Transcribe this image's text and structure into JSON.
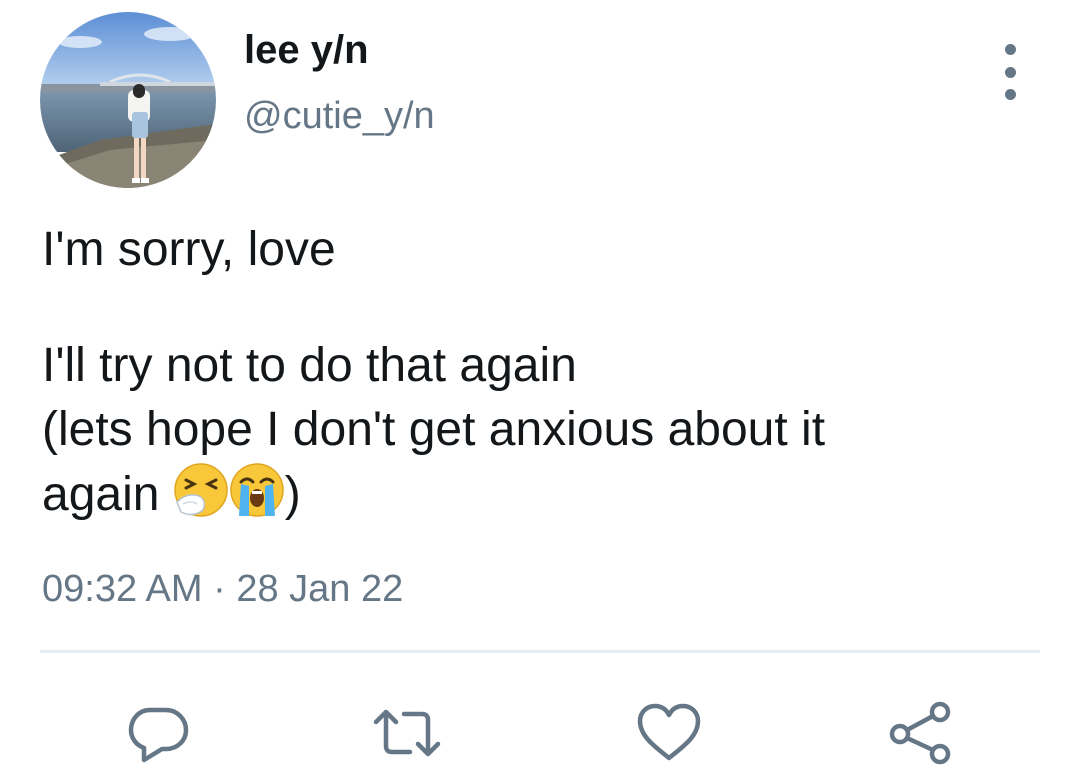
{
  "user": {
    "display_name": "lee y/n",
    "handle": "@cutie_y/n",
    "avatar_icon": "profile-photo-avatar"
  },
  "tweet": {
    "line1": "I'm sorry, love",
    "line2": "I'll try not to do that again",
    "line3": "(lets hope I don't get anxious about it",
    "line4_start": "again ",
    "line4_end": ")",
    "emoji_1": "sneezing-face-emoji",
    "emoji_2": "loudly-crying-face-emoji"
  },
  "meta": {
    "time": "09:32 AM",
    "separator": " · ",
    "date": "28 Jan 22"
  },
  "actions": {
    "reply_icon": "reply-icon",
    "retweet_icon": "retweet-icon",
    "like_icon": "heart-icon",
    "share_icon": "share-icon",
    "more_icon": "more-vertical-icon"
  },
  "colors": {
    "primary_text": "#14171a",
    "secondary_text": "#657786",
    "divider": "#e6ecf0"
  }
}
